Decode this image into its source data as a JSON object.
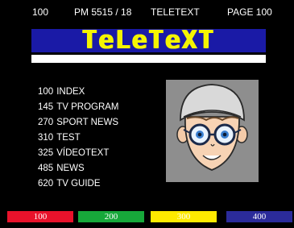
{
  "status_bar": {
    "page": "100",
    "time": "PM 5515 / 18",
    "service": "TELETEXT",
    "current_page": "PAGE 100"
  },
  "header": {
    "title": "TeLeTeXT",
    "banner_color": "#1a1aa6",
    "title_color": "#f5f500"
  },
  "index": [
    {
      "page": "100",
      "label": "INDEX"
    },
    {
      "page": "145",
      "label": "TV PROGRAM"
    },
    {
      "page": "270",
      "label": "SPORT NEWS"
    },
    {
      "page": "310",
      "label": "TEST"
    },
    {
      "page": "325",
      "label": "VÍDEOTEXT"
    },
    {
      "page": "485",
      "label": "NEWS"
    },
    {
      "page": "620",
      "label": "TV GUIDE"
    }
  ],
  "fastext": {
    "red": {
      "label": "100",
      "color": "#e8122b"
    },
    "green": {
      "label": "200",
      "color": "#17a83a"
    },
    "yellow": {
      "label": "300",
      "color": "#ffea00"
    },
    "blue": {
      "label": "400",
      "color": "#2b2b9a"
    }
  },
  "mascot": {
    "icon": "cartoon-face-with-glasses-icon"
  }
}
